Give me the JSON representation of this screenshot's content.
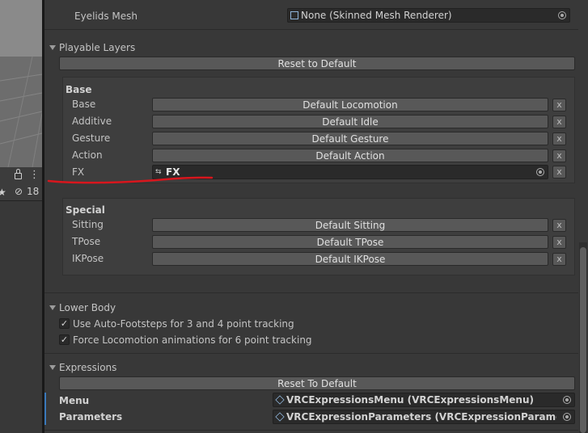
{
  "left_panel": {
    "hidden_count": "18"
  },
  "inspector": {
    "eyelids_mesh": {
      "label": "Eyelids Mesh",
      "value": "None (Skinned Mesh Renderer)"
    },
    "playable_layers": {
      "title": "Playable Layers",
      "reset_label": "Reset to Default",
      "base": {
        "title": "Base",
        "rows": [
          {
            "label": "Base",
            "value": "Default Locomotion"
          },
          {
            "label": "Additive",
            "value": "Default Idle"
          },
          {
            "label": "Gesture",
            "value": "Default Gesture"
          },
          {
            "label": "Action",
            "value": "Default Action"
          }
        ],
        "fx": {
          "label": "FX",
          "value": "FX"
        }
      },
      "special": {
        "title": "Special",
        "rows": [
          {
            "label": "Sitting",
            "value": "Default Sitting"
          },
          {
            "label": "TPose",
            "value": "Default TPose"
          },
          {
            "label": "IKPose",
            "value": "Default IKPose"
          }
        ]
      },
      "clear_label": "x"
    },
    "lower_body": {
      "title": "Lower Body",
      "options": [
        {
          "label": "Use Auto-Footsteps for 3 and 4 point tracking",
          "checked": true
        },
        {
          "label": "Force Locomotion animations for 6 point tracking",
          "checked": true
        }
      ]
    },
    "expressions": {
      "title": "Expressions",
      "reset_label": "Reset To Default",
      "menu": {
        "label": "Menu",
        "value": "VRCExpressionsMenu (VRCExpressionsMenu)"
      },
      "parameters": {
        "label": "Parameters",
        "value": "VRCExpressionParameters (VRCExpressionParameters)"
      }
    }
  },
  "colors": {
    "annotation": "#d8161d",
    "accent": "#3a79bb"
  }
}
